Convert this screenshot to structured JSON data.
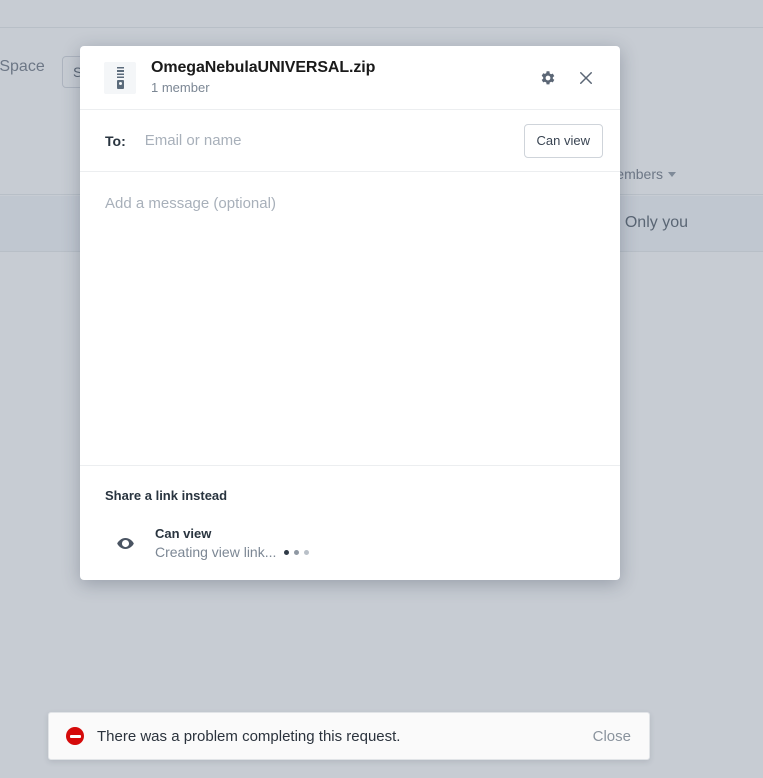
{
  "background": {
    "space_label": "n Space",
    "toolbar_button_label": "S",
    "column_header_members": "Members",
    "row_members_value": "Only you"
  },
  "modal": {
    "file_icon": "zip-file-icon",
    "title": "OmegaNebulaUNIVERSAL.zip",
    "subtitle": "1 member",
    "settings_icon": "gear-icon",
    "close_icon": "close-icon",
    "to": {
      "label": "To:",
      "value": "",
      "placeholder": "Email or name",
      "permission_button_label": "Can view"
    },
    "message": {
      "value": "",
      "placeholder": "Add a message (optional)"
    },
    "share_link": {
      "heading": "Share a link instead",
      "icon": "eye-icon",
      "title": "Can view",
      "status": "Creating view link..."
    }
  },
  "toast": {
    "icon": "error-icon",
    "message": "There was a problem completing this request.",
    "close_label": "Close"
  }
}
